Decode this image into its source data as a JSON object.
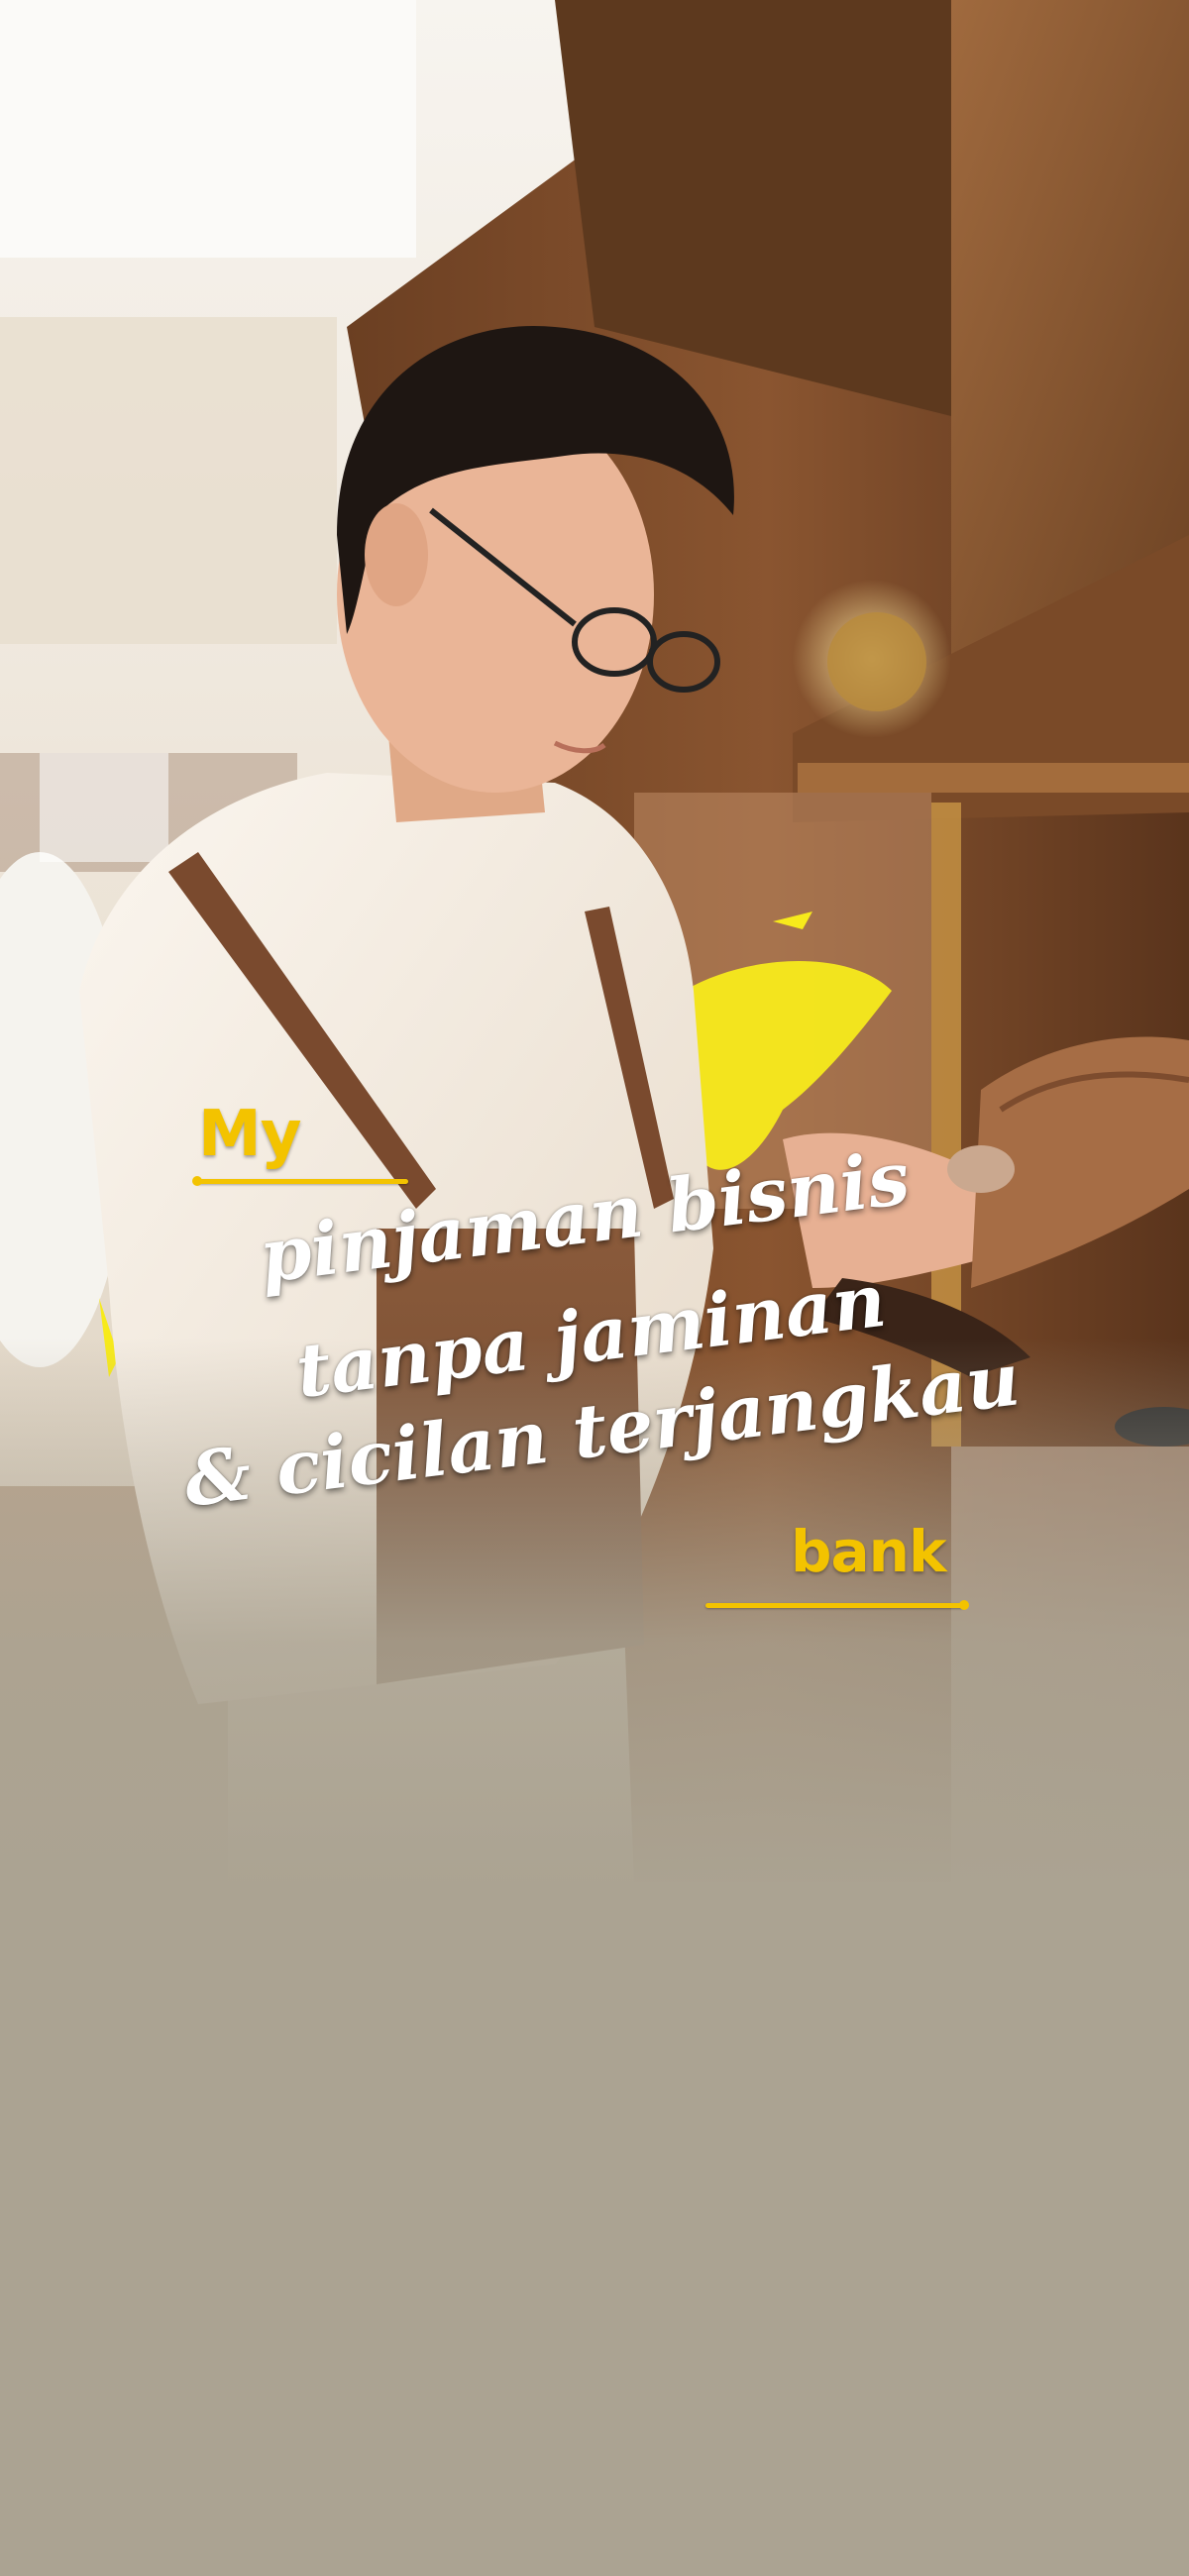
{
  "splash": {
    "brand_prefix": "My",
    "brand_suffix": "bank",
    "headline": {
      "line1": "pinjaman bisnis",
      "line2": "tanpa jaminan",
      "line3": "& cicilan terjangkau"
    }
  },
  "colors": {
    "brand_yellow": "#f3c300",
    "background_beige": "#aba392",
    "headline_text": "#ffffff"
  }
}
